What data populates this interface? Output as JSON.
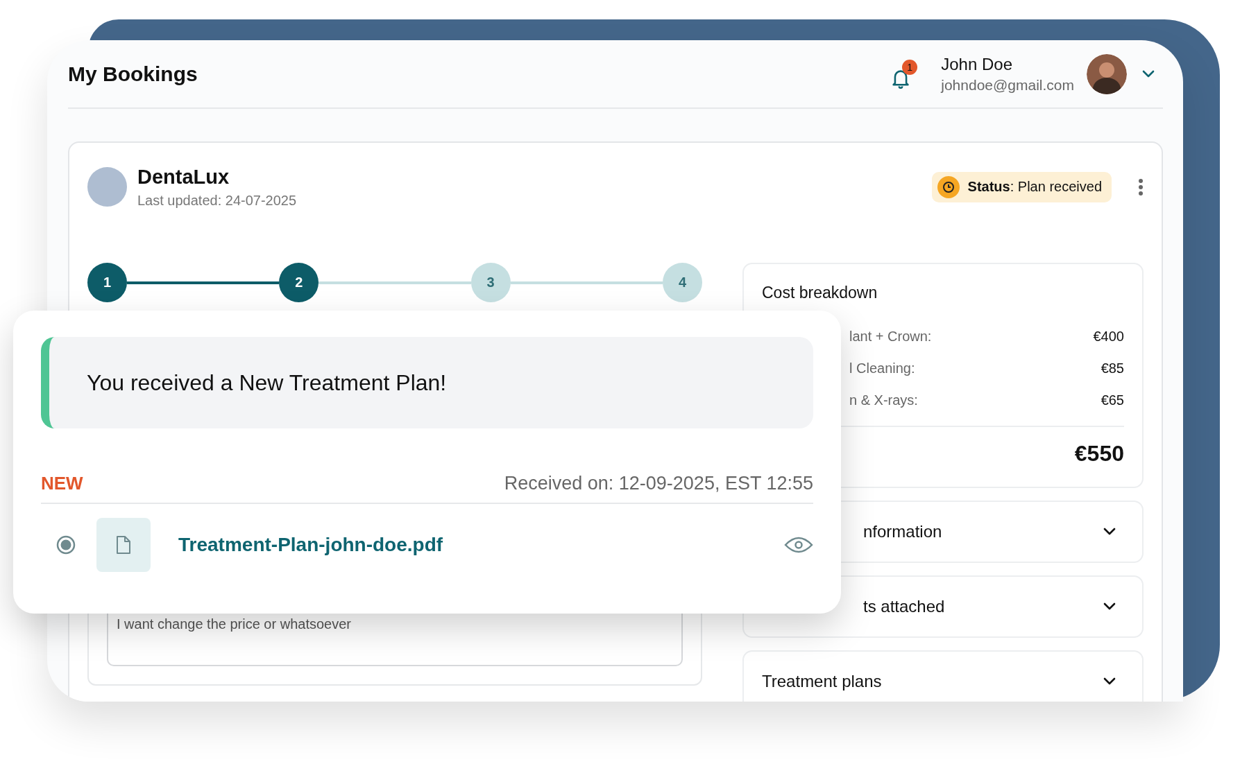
{
  "header": {
    "title": "My Bookings",
    "notifications": {
      "count": "1"
    },
    "user": {
      "name": "John Doe",
      "email": "johndoe@gmail.com"
    }
  },
  "booking": {
    "clinic": "DentaLux",
    "updated": "Last updated: 24-07-2025",
    "status": "**Status**: Plan received",
    "steps": [
      {
        "label": "1",
        "completed": true
      },
      {
        "label": "2",
        "completed": true
      },
      {
        "label": "3",
        "completed": false
      },
      {
        "label": "4",
        "completed": false
      }
    ],
    "feedback": {
      "value": "I want change the price or whatsoever"
    },
    "cost": {
      "title": "Cost breakdown",
      "rows": [
        {
          "label": "lant + Crown:",
          "amount": "€400"
        },
        {
          "label": "l Cleaning:",
          "amount": "€85"
        },
        {
          "label": "n & X-rays:",
          "amount": "€65"
        }
      ],
      "total": "€550"
    },
    "sections": [
      {
        "title": "nformation",
        "expanded": false
      },
      {
        "title": "ts attached",
        "expanded": false
      },
      {
        "title": "Treatment plans",
        "expanded": false
      }
    ]
  },
  "notification": {
    "message": "You received a New Treatment Plan!",
    "badge": "NEW",
    "received": "Received on: 12-09-2025, EST 12:55",
    "file": {
      "name": "Treatment-Plan-john-doe.pdf",
      "selected": true
    }
  }
}
